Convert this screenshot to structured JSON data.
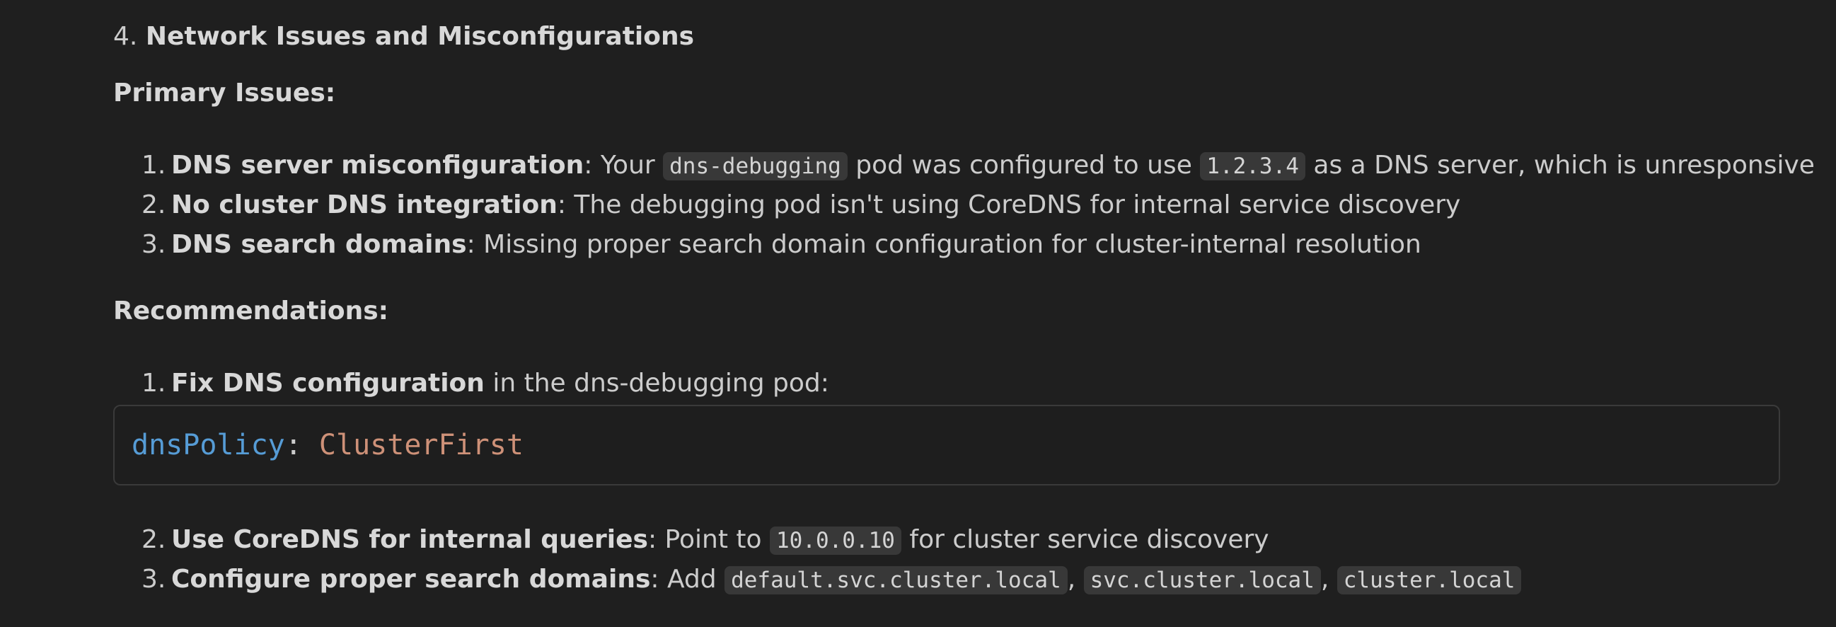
{
  "section": {
    "number": "4.",
    "title": "Network Issues and Misconfigurations"
  },
  "primary": {
    "heading": "Primary Issues:",
    "items": [
      {
        "num": "1.",
        "bold": "DNS server misconfiguration",
        "t1": ": Your ",
        "code1": "dns-debugging",
        "t2": " pod was configured to use ",
        "code2": "1.2.3.4",
        "t3": " as a DNS server, which is unresponsive"
      },
      {
        "num": "2.",
        "bold": "No cluster DNS integration",
        "t1": ": The debugging pod isn't using CoreDNS for internal service discovery"
      },
      {
        "num": "3.",
        "bold": "DNS search domains",
        "t1": ": Missing proper search domain configuration for cluster-internal resolution"
      }
    ]
  },
  "recommendations": {
    "heading": "Recommendations:",
    "item1": {
      "num": "1.",
      "bold": "Fix DNS configuration",
      "t1": " in the dns-debugging pod:"
    },
    "code_block": {
      "key": "dnsPolicy",
      "sep": ": ",
      "value": "ClusterFirst"
    },
    "item2": {
      "num": "2.",
      "bold": "Use CoreDNS for internal queries",
      "t1": ": Point to ",
      "code1": "10.0.0.10",
      "t2": " for cluster service discovery"
    },
    "item3": {
      "num": "3.",
      "bold": "Configure proper search domains",
      "t1": ": Add ",
      "code1": "default.svc.cluster.local",
      "sep1": ", ",
      "code2": "svc.cluster.local",
      "sep2": ", ",
      "code3": "cluster.local"
    }
  }
}
